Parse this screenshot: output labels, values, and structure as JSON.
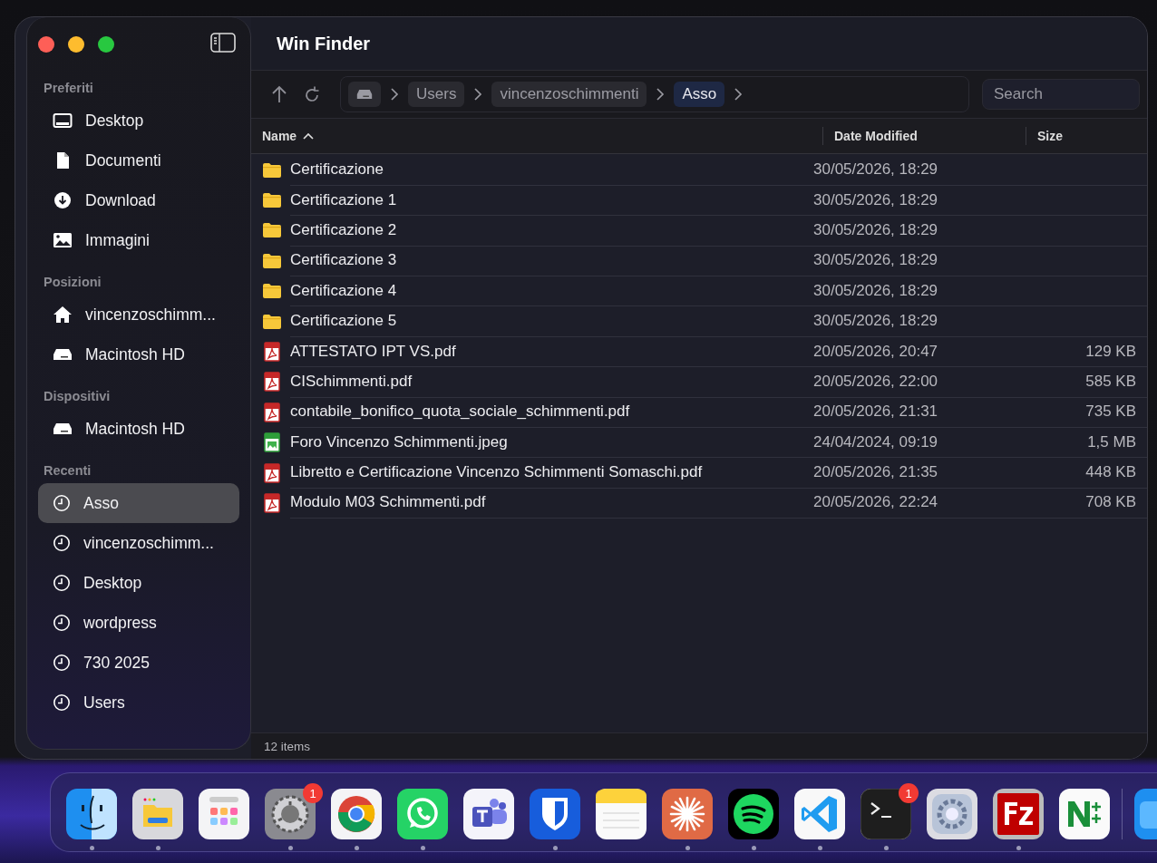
{
  "window": {
    "title": "Win Finder"
  },
  "sidebar": {
    "sections": [
      {
        "title": "Preferiti",
        "items": [
          {
            "kind": "desktop",
            "label": "Desktop",
            "selected": false
          },
          {
            "kind": "document",
            "label": "Documenti",
            "selected": false
          },
          {
            "kind": "download",
            "label": "Download",
            "selected": false
          },
          {
            "kind": "images",
            "label": "Immagini",
            "selected": false
          }
        ]
      },
      {
        "title": "Posizioni",
        "items": [
          {
            "kind": "home",
            "label": "vincenzoschimm...",
            "selected": false
          },
          {
            "kind": "drive",
            "label": "Macintosh HD",
            "selected": false
          }
        ]
      },
      {
        "title": "Dispositivi",
        "items": [
          {
            "kind": "drive",
            "label": "Macintosh HD",
            "selected": false
          }
        ]
      },
      {
        "title": "Recenti",
        "items": [
          {
            "kind": "recent",
            "label": "Asso",
            "selected": true
          },
          {
            "kind": "recent",
            "label": "vincenzoschimm...",
            "selected": false
          },
          {
            "kind": "recent",
            "label": "Desktop",
            "selected": false
          },
          {
            "kind": "recent",
            "label": "wordpress",
            "selected": false
          },
          {
            "kind": "recent",
            "label": "730 2025",
            "selected": false
          },
          {
            "kind": "recent",
            "label": "Users",
            "selected": false
          }
        ]
      }
    ]
  },
  "breadcrumb": [
    {
      "kind": "drive",
      "selected": false
    },
    {
      "kind": "folder",
      "label": "Users",
      "selected": false
    },
    {
      "kind": "folder",
      "label": "vincenzoschimmenti",
      "selected": false
    },
    {
      "kind": "folder",
      "label": "Asso",
      "selected": true
    }
  ],
  "search": {
    "placeholder": "Search"
  },
  "table": {
    "columns": [
      {
        "label": "Name",
        "sorted": true
      },
      {
        "label": "Date Modified",
        "sorted": false
      },
      {
        "label": "Size",
        "sorted": false
      }
    ],
    "rows": [
      {
        "kind": "folder",
        "name": "Certificazione",
        "date": "30/05/2026, 18:29"
      },
      {
        "kind": "folder",
        "name": "Certificazione 1",
        "date": "30/05/2026, 18:29"
      },
      {
        "kind": "folder",
        "name": "Certificazione 2",
        "date": "30/05/2026, 18:29"
      },
      {
        "kind": "folder",
        "name": "Certificazione 3",
        "date": "30/05/2026, 18:29"
      },
      {
        "kind": "folder",
        "name": "Certificazione 4",
        "date": "30/05/2026, 18:29"
      },
      {
        "kind": "folder",
        "name": "Certificazione 5",
        "date": "30/05/2026, 18:29"
      },
      {
        "kind": "pdf",
        "name": "ATTESTATO IPT VS.pdf",
        "date": "20/05/2026, 20:47",
        "size": "129 KB"
      },
      {
        "kind": "pdf",
        "name": "CISchimmenti.pdf",
        "date": "20/05/2026, 22:00",
        "size": "585 KB"
      },
      {
        "kind": "pdf",
        "name": "contabile_bonifico_quota_sociale_schimmenti.pdf",
        "date": "20/05/2026, 21:31",
        "size": "735 KB"
      },
      {
        "kind": "image",
        "name": "Foro Vincenzo Schimmenti.jpeg",
        "date": "24/04/2024, 09:19",
        "size": "1,5 MB"
      },
      {
        "kind": "pdf",
        "name": "Libretto e Certificazione Vincenzo Schimmenti Somaschi.pdf",
        "date": "20/05/2026, 21:35",
        "size": "448 KB"
      },
      {
        "kind": "pdf",
        "name": "Modulo M03 Schimmenti.pdf",
        "date": "20/05/2026, 22:24",
        "size": "708 KB"
      }
    ]
  },
  "status_bar": {
    "text": "12 items"
  },
  "dock": [
    {
      "kind": "finder",
      "running": true
    },
    {
      "kind": "files",
      "running": true
    },
    {
      "kind": "launchpad",
      "running": false
    },
    {
      "kind": "settings",
      "running": true,
      "badge": "1"
    },
    {
      "kind": "chrome",
      "running": true
    },
    {
      "kind": "whatsapp",
      "running": true
    },
    {
      "kind": "teams",
      "running": false
    },
    {
      "kind": "bitwarden",
      "running": true
    },
    {
      "kind": "notes",
      "running": false
    },
    {
      "kind": "claude",
      "running": true
    },
    {
      "kind": "spotify",
      "running": true
    },
    {
      "kind": "vscode",
      "running": true
    },
    {
      "kind": "terminal",
      "running": true,
      "badge": "1"
    },
    {
      "kind": "gear",
      "running": false
    },
    {
      "kind": "filezilla",
      "running": true
    },
    {
      "kind": "notepad",
      "running": false
    },
    {
      "kind": "separator"
    },
    {
      "kind": "blue"
    }
  ]
}
